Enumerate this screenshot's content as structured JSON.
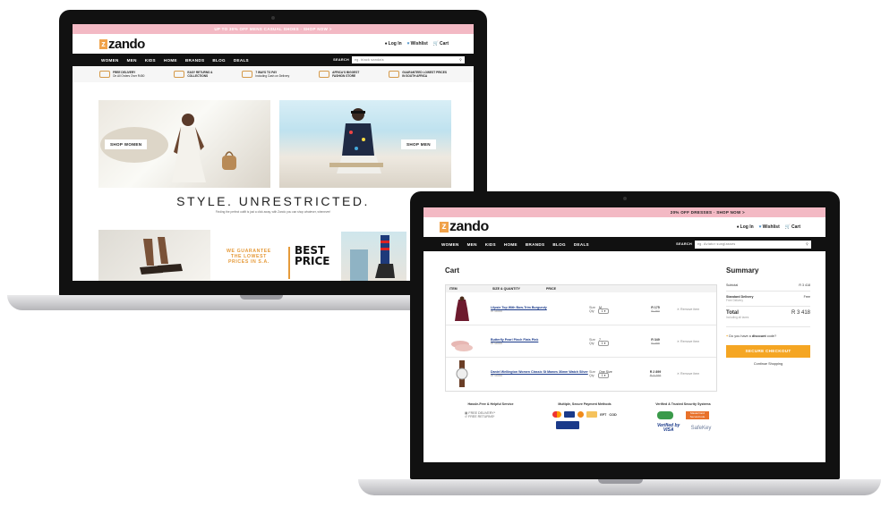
{
  "colors": {
    "promo": "#f3b9c4",
    "brand_orange": "#f0a24a",
    "nav_bg": "#111111",
    "checkout": "#f5a623"
  },
  "laptop1": {
    "promo": "UP TO 30% OFF MENS CASUAL SHOES · SHOP NOW >",
    "logo": "zando",
    "login": "Log In",
    "wishlist": "Wishlist",
    "cart": "Cart",
    "nav": [
      "WOMEN",
      "MEN",
      "KIDS",
      "HOME",
      "BRANDS",
      "BLOG",
      "DEALS"
    ],
    "search_label": "SEARCH",
    "search_placeholder": "eg. black sandals",
    "benefits": [
      {
        "title": "FREE DELIVERY",
        "sub": "On All Orders Over R450"
      },
      {
        "title": "EASY RETURNS &",
        "sub": "COLLECTIONS"
      },
      {
        "title": "7 WAYS TO PAY",
        "sub": "Including Cash on Delivery"
      },
      {
        "title": "AFRICA'S BIGGEST",
        "sub": "FASHION STORE"
      },
      {
        "title": "GUARANTEED LOWEST PRICES",
        "sub": "IN SOUTH AFRICA"
      }
    ],
    "shop_women": "SHOP WOMEN",
    "shop_men": "SHOP MEN",
    "headline": "STYLE. UNRESTRICTED.",
    "tagline": "Finding the perfect outfit is just a click away, with Zando you can shop whatever, whenever!",
    "guarantee": [
      "WE GUARANTEE",
      "THE LOWEST",
      "PRICES IN S.A."
    ],
    "best_price": [
      "BEST",
      "PRICE"
    ]
  },
  "laptop2": {
    "promo": "20% OFF DRESSES · SHOP NOW >",
    "logo": "zando",
    "login": "Log In",
    "wishlist": "Wishlist",
    "cart": "Cart",
    "nav": [
      "WOMEN",
      "MEN",
      "KIDS",
      "HOME",
      "BRANDS",
      "BLOG",
      "DEALS"
    ],
    "search_label": "SEARCH",
    "search_placeholder": "eg. Aviator sunglasses",
    "cart_title": "Cart",
    "headers": {
      "item": "ITEM",
      "size_qty": "SIZE & QUANTITY",
      "price": "PRICE"
    },
    "items": [
      {
        "name": "Lilpsie Top With Bow-Trim Burgundy",
        "stock": "In Stock",
        "size_label": "Size",
        "size": "M",
        "qty_label": "Qty",
        "qty": "1",
        "price": "R 175",
        "old_price": "R 260",
        "remove": "Remove item"
      },
      {
        "name": "Butterfly Pearl Pinch Flats Pink",
        "stock": "In Stock",
        "size_label": "Size",
        "size": "7",
        "qty_label": "Qty",
        "qty": "1",
        "price": "R 349",
        "old_price": "R 499",
        "remove": "Remove item"
      },
      {
        "name": "Daniel Wellington Women Classic St Mawes 36mm Watch Silver",
        "stock": "In Stock",
        "size_label": "Size",
        "size": "One Size",
        "qty_label": "Qty",
        "qty": "1",
        "price": "R 2 899",
        "old_price": "R 3 299",
        "remove": "Remove item"
      }
    ],
    "summary": {
      "title": "Summary",
      "subtotal_label": "Subtotal",
      "subtotal": "R 3 418",
      "delivery_label": "Standard Delivery",
      "delivery": "Free",
      "delivery_note": "Free Delivery",
      "total_label": "Total",
      "total": "R 3 418",
      "vat_note": "Including all taxes",
      "discount_prefix": "Do you have a ",
      "discount_bold": "discount",
      "discount_suffix": " code?",
      "checkout": "SECURE CHECKOUT",
      "continue": "Continue Shopping"
    },
    "footer": {
      "col1_title": "Hassle-Free & Helpful Service",
      "col1_lines": [
        "FREE DELIVERY*",
        "FREE RETURNS*"
      ],
      "col2_title": "Multiple, Secure Payment Methods",
      "col3_title": "Verified & Trusted Security Systems",
      "verified_visa": "Verified by VISA",
      "safekey": "SafeKey",
      "mastercard": "MasterCard SecureCode",
      "eft": "EFT",
      "cod": "COD"
    }
  }
}
